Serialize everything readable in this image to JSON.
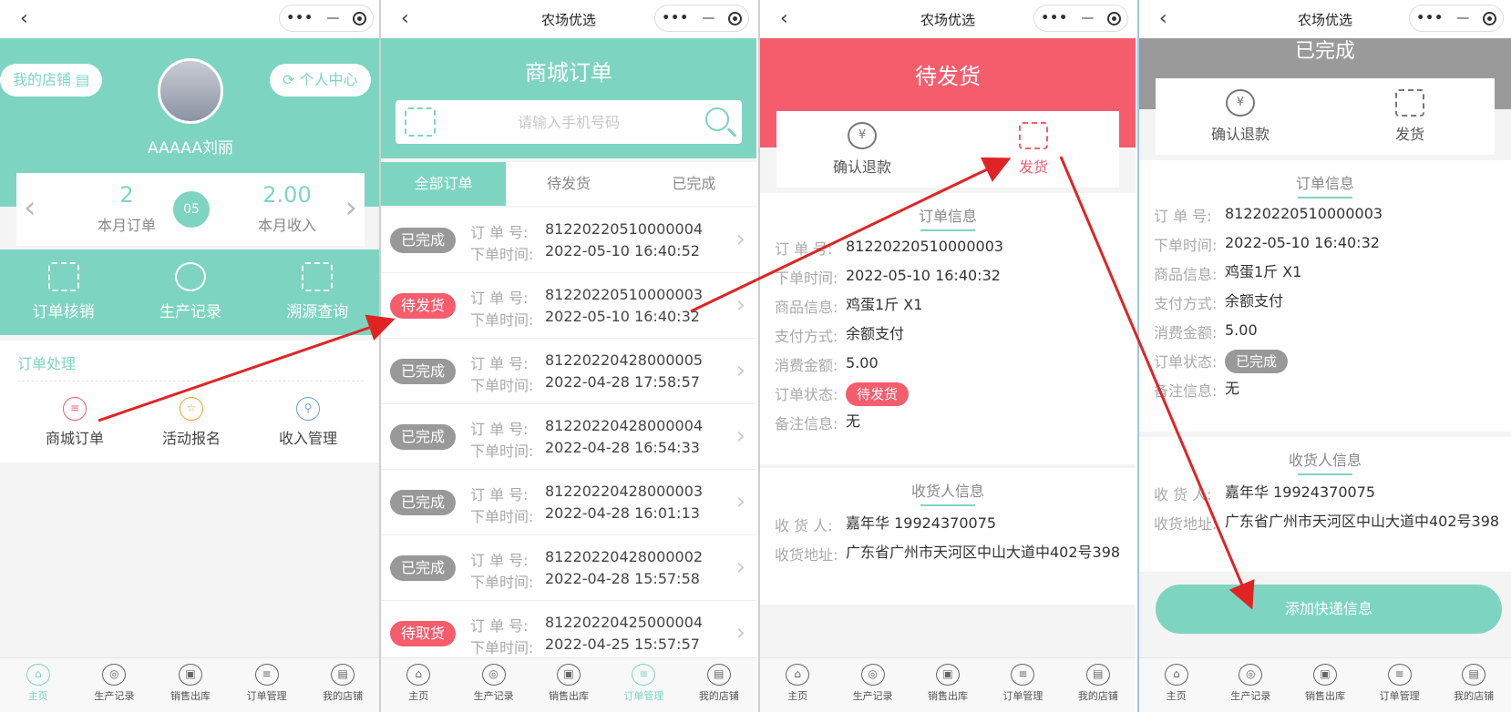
{
  "capsule": {
    "dots": "•••",
    "minus": "—"
  },
  "screen1": {
    "title": "",
    "my_shop": "我的店铺",
    "personal_center": "个人中心",
    "user_name": "AAAAA刘丽",
    "stats": {
      "orders_value": "2",
      "orders_label": "本月订单",
      "month": "05",
      "income_value": "2.00",
      "income_label": "本月收入"
    },
    "quick": [
      "订单核销",
      "生产记录",
      "溯源查询"
    ],
    "section_title": "订单处理",
    "items": [
      "商城订单",
      "活动报名",
      "收入管理"
    ]
  },
  "screen2": {
    "title": "农场优选",
    "header": "商城订单",
    "search_placeholder": "请输入手机号码",
    "tabs": [
      "全部订单",
      "待发货",
      "已完成"
    ],
    "label_no": "订 单 号:",
    "label_time": "下单时间:",
    "orders": [
      {
        "status": "已完成",
        "type": "done",
        "no": "81220220510000004",
        "time": "2022-05-10 16:40:52"
      },
      {
        "status": "待发货",
        "type": "wait",
        "no": "81220220510000003",
        "time": "2022-05-10 16:40:32"
      },
      {
        "status": "已完成",
        "type": "done",
        "no": "81220220428000005",
        "time": "2022-04-28 17:58:57"
      },
      {
        "status": "已完成",
        "type": "done",
        "no": "81220220428000004",
        "time": "2022-04-28 16:54:33"
      },
      {
        "status": "已完成",
        "type": "done",
        "no": "81220220428000003",
        "time": "2022-04-28 16:01:13"
      },
      {
        "status": "已完成",
        "type": "done",
        "no": "81220220428000002",
        "time": "2022-04-28 15:57:58"
      },
      {
        "status": "待取货",
        "type": "wait",
        "no": "81220220425000004",
        "time": "2022-04-25 15:57:57"
      }
    ]
  },
  "screen3": {
    "title": "农场优选",
    "header": "待发货",
    "actions": [
      "确认退款",
      "发货"
    ],
    "info_title": "订单信息",
    "info": [
      {
        "k": "订 单 号:",
        "v": "81220220510000003"
      },
      {
        "k": "下单时间:",
        "v": "2022-05-10 16:40:32"
      },
      {
        "k": "商品信息:",
        "v": "鸡蛋1斤 X1"
      },
      {
        "k": "支付方式:",
        "v": "余额支付"
      },
      {
        "k": "消费金额:",
        "v": "5.00"
      },
      {
        "k": "订单状态:",
        "v": "待发货"
      },
      {
        "k": "备注信息:",
        "v": "无"
      }
    ],
    "receiver_title": "收货人信息",
    "receiver": [
      {
        "k": "收 货 人:",
        "v": "嘉年华 19924370075"
      },
      {
        "k": "收货地址:",
        "v": "广东省广州市天河区中山大道中402号398"
      }
    ]
  },
  "screen4": {
    "title": "农场优选",
    "header": "已完成",
    "actions": [
      "确认退款",
      "发货"
    ],
    "info_title": "订单信息",
    "info": [
      {
        "k": "订 单 号:",
        "v": "81220220510000003"
      },
      {
        "k": "下单时间:",
        "v": "2022-05-10 16:40:32"
      },
      {
        "k": "商品信息:",
        "v": "鸡蛋1斤 X1"
      },
      {
        "k": "支付方式:",
        "v": "余额支付"
      },
      {
        "k": "消费金额:",
        "v": "5.00"
      },
      {
        "k": "订单状态:",
        "v": "已完成"
      },
      {
        "k": "备注信息:",
        "v": "无"
      }
    ],
    "receiver_title": "收货人信息",
    "receiver": [
      {
        "k": "收 货 人:",
        "v": "嘉年华 19924370075"
      },
      {
        "k": "收货地址:",
        "v": "广东省广州市天河区中山大道中402号398"
      }
    ],
    "add_button": "添加快递信息"
  },
  "tabbar": [
    "主页",
    "生产记录",
    "销售出库",
    "订单管理",
    "我的店铺"
  ],
  "colors": {
    "teal": "#7dd5c1",
    "red": "#f55d6d",
    "gray": "#999999",
    "arrow": "#e02424"
  }
}
